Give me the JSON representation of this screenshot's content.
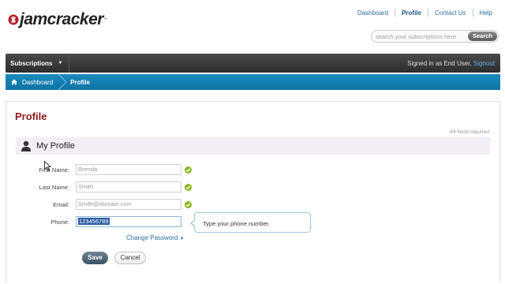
{
  "brand": {
    "name": "jamcracker"
  },
  "topnav": {
    "items": [
      {
        "label": "Dashboard",
        "active": false
      },
      {
        "label": "Profile",
        "active": true
      },
      {
        "label": "Contact Us",
        "active": false
      },
      {
        "label": "Help",
        "active": false
      }
    ]
  },
  "search": {
    "placeholder": "search your subscriptions here",
    "button": "Search"
  },
  "menubar": {
    "subscriptions": "Subscriptions",
    "signed_in_text": "Signed in as End User,",
    "signout": "Signout"
  },
  "breadcrumb": {
    "home": "Dashboard",
    "current": "Profile"
  },
  "page": {
    "title": "Profile",
    "required_note": "All fields required",
    "section_title": "My Profile"
  },
  "form": {
    "first_name": {
      "label": "First Name:",
      "value": "Brenda"
    },
    "last_name": {
      "label": "Last Name:",
      "value": "Smith"
    },
    "email": {
      "label": "Email:",
      "value": "Smith@domain.com"
    },
    "phone": {
      "label": "Phone:",
      "value": "123456789"
    },
    "phone_tip": "Type your phone number.",
    "change_password": "Change Password",
    "save": "Save",
    "cancel": "Cancel"
  },
  "colors": {
    "title_red": "#8b1a1a",
    "nav_blue": "#2a6f9e",
    "crumb_blue": "#1282b6",
    "check_green": "#8bb81f"
  }
}
